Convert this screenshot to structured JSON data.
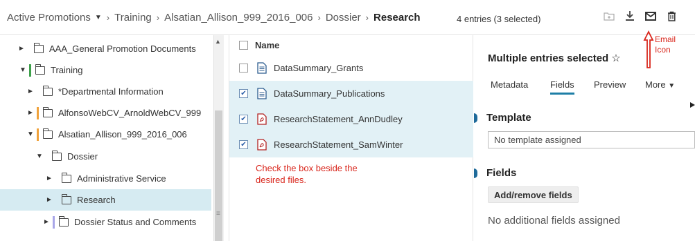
{
  "breadcrumb": {
    "items": [
      "Active Promotions",
      "Training",
      "Alsatian_Allison_999_2016_006",
      "Dossier"
    ],
    "current": "Research"
  },
  "entry_count": "4 entries (3 selected)",
  "toolbar": {
    "icons": [
      "add-folder-icon",
      "download-icon",
      "email-icon",
      "trash-icon"
    ]
  },
  "annotations": {
    "email_line1": "Email",
    "email_line2": "Icon",
    "checkbox_hint_line1": "Check the box beside the",
    "checkbox_hint_line2": "desired files."
  },
  "tree": {
    "items": [
      {
        "label": "AAA_General Promotion Documents",
        "expanded": false
      },
      {
        "label": "Training",
        "expanded": true
      },
      {
        "label": "*Departmental Information",
        "expanded": false
      },
      {
        "label": "AlfonsoWebCV_ArnoldWebCV_999",
        "expanded": false
      },
      {
        "label": "Alsatian_Allison_999_2016_006",
        "expanded": true
      },
      {
        "label": "Dossier",
        "expanded": true
      },
      {
        "label": "Administrative Service",
        "expanded": false
      },
      {
        "label": "Research",
        "expanded": false,
        "selected": true
      },
      {
        "label": "Dossier Status and Comments",
        "expanded": false
      }
    ]
  },
  "filelist": {
    "header": "Name",
    "rows": [
      {
        "name": "DataSummary_Grants",
        "checked": false,
        "icon": "document-icon"
      },
      {
        "name": "DataSummary_Publications",
        "checked": true,
        "icon": "document-icon"
      },
      {
        "name": "ResearchStatement_AnnDudley",
        "checked": true,
        "icon": "pdf-icon"
      },
      {
        "name": "ResearchStatement_SamWinter",
        "checked": true,
        "icon": "pdf-icon"
      }
    ]
  },
  "panel": {
    "title": "Multiple entries selected",
    "tabs": [
      "Metadata",
      "Fields",
      "Preview",
      "More"
    ],
    "active_tab": "Fields",
    "template_heading": "Template",
    "template_value": "No template assigned",
    "fields_heading": "Fields",
    "add_remove_label": "Add/remove fields",
    "no_fields_text": "No additional fields assigned"
  },
  "colors": {
    "accent": "#1e6a9a",
    "selected_row": "#d6ebf2",
    "checked_row": "#e2f1f6",
    "annotation": "#d9261c",
    "bar_green": "#3da04a",
    "bar_orange": "#f0a23c",
    "bar_purple": "#a9a6e8"
  }
}
